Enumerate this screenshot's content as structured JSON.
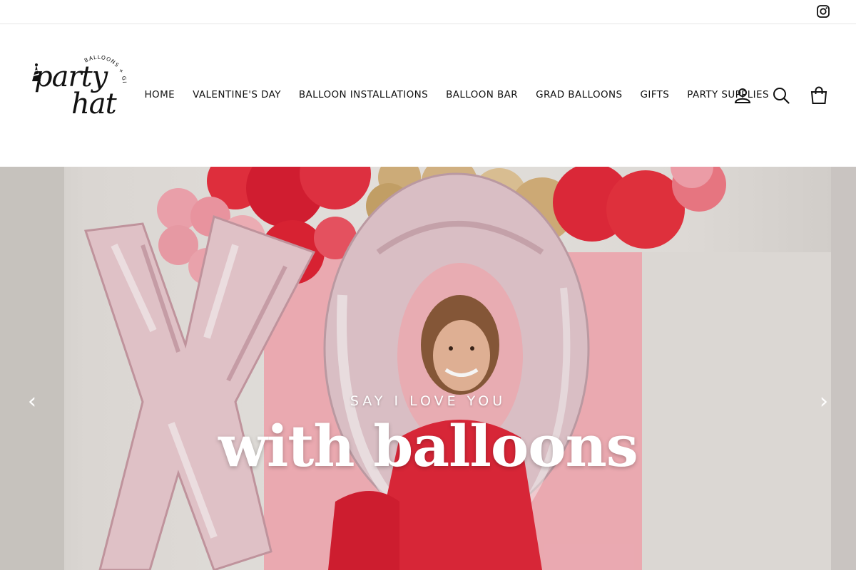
{
  "topbar": {
    "social": [
      {
        "icon": "instagram-icon"
      }
    ]
  },
  "logo": {
    "line1": "party",
    "line2": "hat",
    "tagline": "BALLOONS + GIFTS"
  },
  "nav": {
    "items": [
      {
        "label": "HOME"
      },
      {
        "label": "VALENTINE'S DAY"
      },
      {
        "label": "BALLOON INSTALLATIONS"
      },
      {
        "label": "BALLOON BAR"
      },
      {
        "label": "GRAD BALLOONS"
      },
      {
        "label": "GIFTS"
      },
      {
        "label": "PARTY SUPPLIES"
      }
    ]
  },
  "header_icons": {
    "account": "user-icon",
    "search": "search-icon",
    "cart": "cart-icon"
  },
  "hero": {
    "kicker": "SAY I LOVE YOU",
    "headline": "with balloons",
    "prev": "‹",
    "next": "›"
  },
  "colors": {
    "accent_red": "#e0283a",
    "balloon_pink": "#f2a3ad",
    "gold": "#c9a56a",
    "text": "#111111"
  }
}
